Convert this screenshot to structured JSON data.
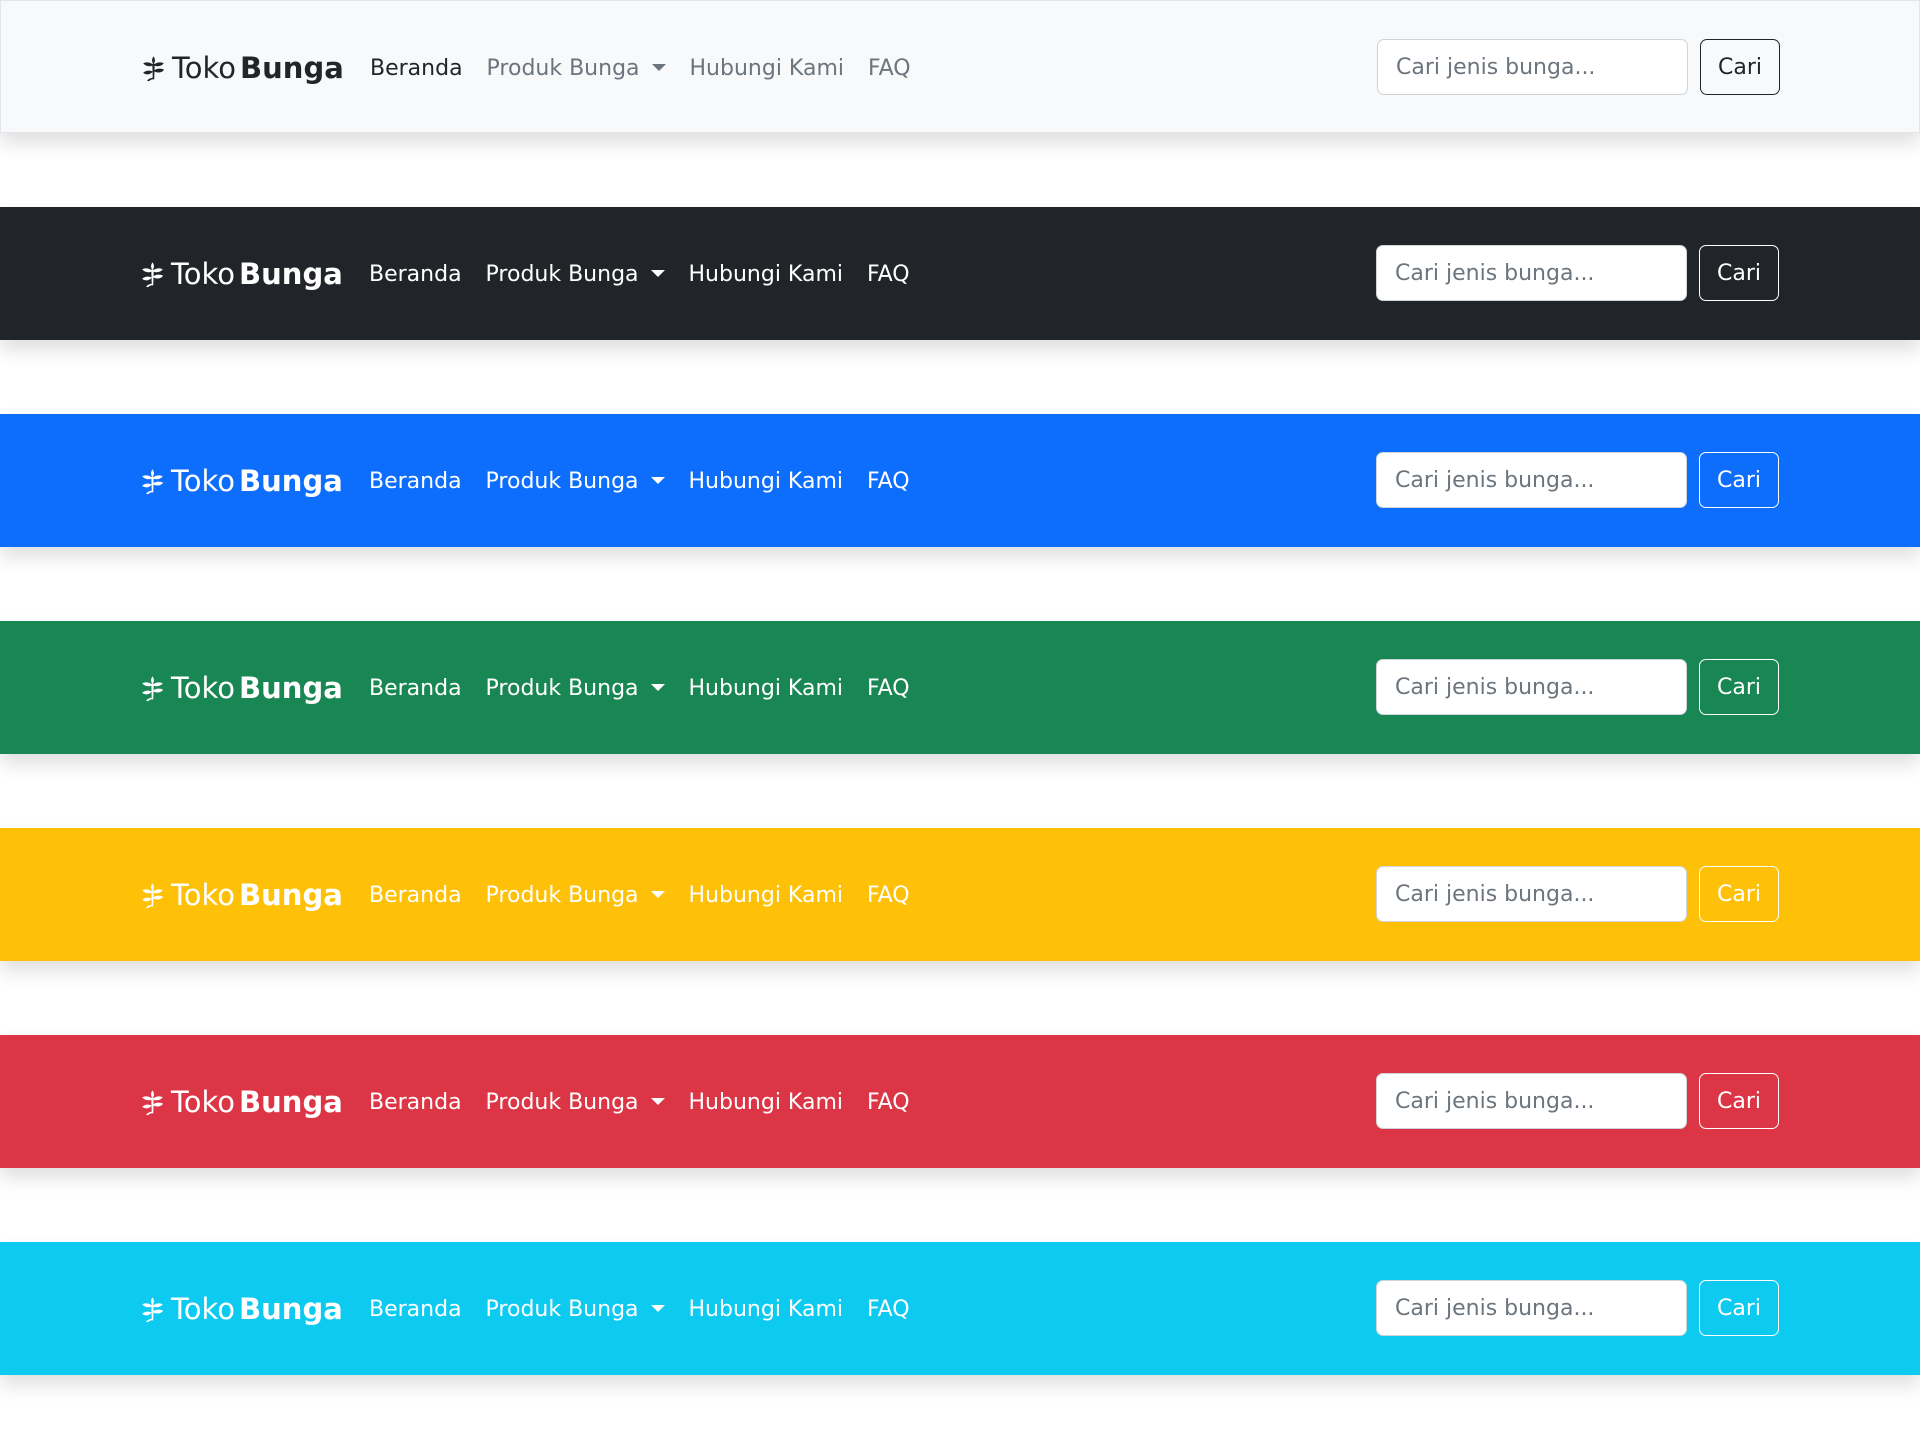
{
  "brand": {
    "name_light": "Toko",
    "name_bold": "Bunga",
    "icon": "flower-icon"
  },
  "nav": {
    "home": "Beranda",
    "products": "Produk Bunga",
    "contact": "Hubungi Kami",
    "faq": "FAQ"
  },
  "search": {
    "placeholder": "Cari jenis bunga...",
    "button": "Cari"
  },
  "navbars": [
    {
      "variant": "light",
      "bg": "#f8f9fa",
      "fg": "#212529",
      "muted": "#6c757d",
      "btn_color": "#212529",
      "btn_border": "#212529"
    },
    {
      "variant": "dark",
      "bg": "#212529",
      "fg": "#ffffff",
      "muted": "#ffffff",
      "btn_color": "#ffffff",
      "btn_border": "#ffffff"
    },
    {
      "variant": "primary",
      "bg": "#0d6efd",
      "fg": "#ffffff",
      "muted": "#ffffff",
      "btn_color": "#ffffff",
      "btn_border": "#ffffff"
    },
    {
      "variant": "success",
      "bg": "#198754",
      "fg": "#ffffff",
      "muted": "#ffffff",
      "btn_color": "#ffffff",
      "btn_border": "#ffffff"
    },
    {
      "variant": "warning",
      "bg": "#ffc107",
      "fg": "#ffffff",
      "muted": "#ffffff",
      "btn_color": "#ffffff",
      "btn_border": "#ffffff"
    },
    {
      "variant": "danger",
      "bg": "#dc3545",
      "fg": "#ffffff",
      "muted": "#ffffff",
      "btn_color": "#ffffff",
      "btn_border": "#ffffff"
    },
    {
      "variant": "info",
      "bg": "#0dcaf0",
      "fg": "#ffffff",
      "muted": "#ffffff",
      "btn_color": "#ffffff",
      "btn_border": "#ffffff"
    }
  ]
}
